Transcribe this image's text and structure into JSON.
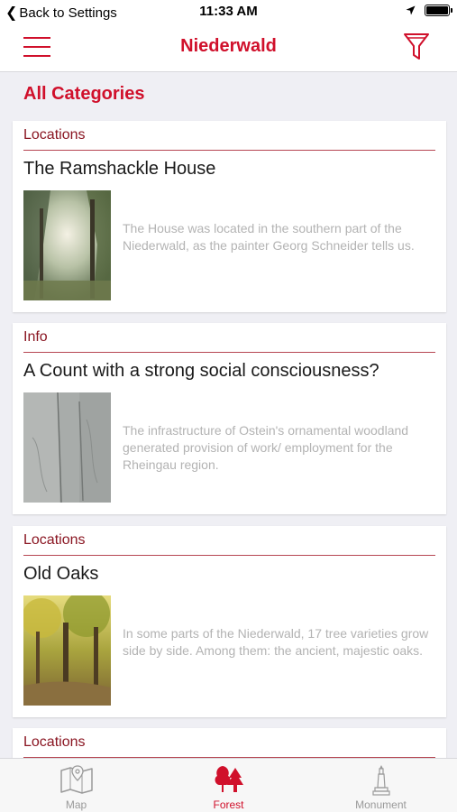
{
  "status_bar": {
    "back_label": "Back to Settings",
    "time": "11:33 AM"
  },
  "nav": {
    "title": "Niederwald"
  },
  "section_title": "All Categories",
  "cards": [
    {
      "category": "Locations",
      "title": "The Ramshackle House",
      "text": "The House was located in the southern part of the Niederwald, as the painter Georg Schneider tells us."
    },
    {
      "category": "Info",
      "title": "A Count with a strong social consciousness?",
      "text": "The infrastructure of Ostein's ornamental woodland generated provision of work/ employment for the Rheingau region."
    },
    {
      "category": "Locations",
      "title": "Old Oaks",
      "text": "In some parts of the Niederwald, 17 tree varieties grow side by side. Among them: the ancient, majestic oaks."
    },
    {
      "category": "Locations"
    }
  ],
  "tabs": [
    {
      "label": "Map",
      "icon": "map-icon"
    },
    {
      "label": "Forest",
      "icon": "forest-icon",
      "active": true
    },
    {
      "label": "Monument",
      "icon": "monument-icon"
    }
  ],
  "colors": {
    "accent": "#d0102b",
    "category": "#8a1622",
    "muted_text": "#b3b3b3"
  }
}
